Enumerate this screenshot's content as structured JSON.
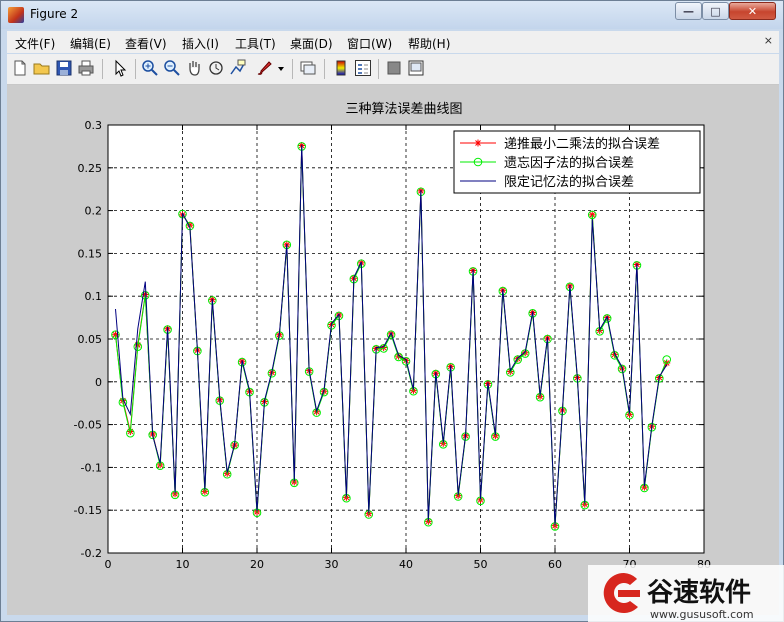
{
  "window": {
    "title": "Figure 2",
    "controls": {
      "minimize": "—",
      "maximize": "□",
      "close": "✕"
    }
  },
  "menubar": {
    "items": [
      "文件(F)",
      "编辑(E)",
      "查看(V)",
      "插入(I)",
      "工具(T)",
      "桌面(D)",
      "窗口(W)",
      "帮助(H)"
    ],
    "close_glyph": "⨯"
  },
  "toolbar": {
    "icons": [
      "new-file-icon",
      "open-folder-icon",
      "save-icon",
      "print-icon",
      "pointer-icon",
      "zoom-in-icon",
      "zoom-out-icon",
      "pan-hand-icon",
      "rotate-3d-icon",
      "data-cursor-icon",
      "brush-icon",
      "dropdown-arrow-icon",
      "link-plot-icon",
      "colorbar-icon",
      "legend-icon",
      "hide-plot-tools-icon",
      "show-plot-tools-icon"
    ]
  },
  "colors": {
    "series1": "#ff0000",
    "series2": "#00ee00",
    "series3": "#000080",
    "figure_bg": "#cccccc"
  },
  "chart_data": {
    "type": "line",
    "title": "三种算法误差曲线图",
    "xlabel": "",
    "ylabel": "",
    "xlim": [
      0,
      80
    ],
    "ylim": [
      -0.2,
      0.3
    ],
    "xticks": [
      "0",
      "10",
      "20",
      "30",
      "40",
      "50",
      "60",
      "70",
      "80"
    ],
    "yticks": [
      "0.3",
      "0.25",
      "0.2",
      "0.15",
      "0.1",
      "0.05",
      "0",
      "-0.05",
      "-0.1",
      "-0.15",
      "-0.2"
    ],
    "grid": true,
    "legend_position": "top-right",
    "x": [
      1,
      2,
      3,
      4,
      5,
      6,
      7,
      8,
      9,
      10,
      11,
      12,
      13,
      14,
      15,
      16,
      17,
      18,
      19,
      20,
      21,
      22,
      23,
      24,
      25,
      26,
      27,
      28,
      29,
      30,
      31,
      32,
      33,
      34,
      35,
      36,
      37,
      38,
      39,
      40,
      41,
      42,
      43,
      44,
      45,
      46,
      47,
      48,
      49,
      50,
      51,
      52,
      53,
      54,
      55,
      56,
      57,
      58,
      59,
      60,
      61,
      62,
      63,
      64,
      65,
      66,
      67,
      68,
      69,
      70,
      71,
      72,
      73,
      74,
      75
    ],
    "series": [
      {
        "name": "递推最小二乘法的拟合误差",
        "marker": "*",
        "color": "#ff0000",
        "values": [
          0.055,
          -0.022,
          -0.058,
          0.043,
          0.102,
          -0.061,
          -0.097,
          0.062,
          -0.131,
          0.195,
          0.183,
          0.037,
          -0.128,
          0.096,
          -0.021,
          -0.107,
          -0.074,
          0.024,
          -0.011,
          -0.152,
          -0.023,
          0.011,
          0.055,
          0.16,
          -0.117,
          0.276,
          0.013,
          -0.035,
          -0.011,
          0.067,
          0.078,
          -0.135,
          0.121,
          0.139,
          -0.154,
          0.039,
          0.04,
          0.056,
          0.03,
          0.025,
          -0.01,
          0.223,
          -0.163,
          0.01,
          -0.072,
          0.018,
          -0.133,
          -0.063,
          0.13,
          -0.138,
          -0.002,
          -0.063,
          0.107,
          0.012,
          0.027,
          0.034,
          0.081,
          -0.017,
          0.051,
          -0.168,
          -0.033,
          0.112,
          0.005,
          -0.143,
          0.195,
          0.06,
          0.075,
          0.032,
          0.016,
          -0.038,
          0.137,
          -0.123,
          -0.052,
          0.005,
          0.022
        ]
      },
      {
        "name": "遗忘因子法的拟合误差",
        "marker": "o",
        "color": "#00ee00",
        "values": [
          0.055,
          -0.024,
          -0.06,
          0.041,
          0.101,
          -0.062,
          -0.098,
          0.061,
          -0.132,
          0.196,
          0.182,
          0.036,
          -0.129,
          0.095,
          -0.022,
          -0.108,
          -0.074,
          0.023,
          -0.012,
          -0.153,
          -0.024,
          0.01,
          0.054,
          0.16,
          -0.118,
          0.275,
          0.012,
          -0.036,
          -0.012,
          0.066,
          0.077,
          -0.136,
          0.12,
          0.138,
          -0.155,
          0.038,
          0.039,
          0.055,
          0.029,
          0.024,
          -0.011,
          0.222,
          -0.164,
          0.009,
          -0.073,
          0.017,
          -0.134,
          -0.064,
          0.129,
          -0.139,
          -0.003,
          -0.064,
          0.106,
          0.011,
          0.026,
          0.033,
          0.08,
          -0.018,
          0.05,
          -0.169,
          -0.034,
          0.111,
          0.004,
          -0.144,
          0.195,
          0.059,
          0.074,
          0.031,
          0.015,
          -0.039,
          0.136,
          -0.124,
          -0.053,
          0.004,
          0.026
        ]
      },
      {
        "name": "限定记忆法的拟合误差",
        "marker": "",
        "color": "#000080",
        "values": [
          0.085,
          -0.02,
          -0.038,
          0.062,
          0.117,
          -0.063,
          -0.095,
          0.064,
          -0.13,
          0.197,
          0.18,
          0.038,
          -0.126,
          0.097,
          -0.02,
          -0.106,
          -0.073,
          0.025,
          -0.01,
          -0.151,
          -0.022,
          0.012,
          0.056,
          0.161,
          -0.116,
          0.277,
          0.014,
          -0.034,
          -0.01,
          0.068,
          0.079,
          -0.134,
          0.122,
          0.14,
          -0.153,
          0.04,
          0.041,
          0.057,
          0.031,
          0.026,
          -0.009,
          0.224,
          -0.162,
          0.011,
          -0.071,
          0.019,
          -0.132,
          -0.062,
          0.131,
          -0.137,
          -0.001,
          -0.062,
          0.108,
          0.013,
          0.028,
          0.035,
          0.082,
          -0.016,
          0.052,
          -0.167,
          -0.032,
          0.113,
          0.006,
          -0.142,
          0.19,
          0.061,
          0.076,
          0.033,
          0.017,
          -0.037,
          0.138,
          -0.122,
          -0.051,
          0.006,
          0.02
        ]
      }
    ]
  },
  "watermark": {
    "brand": "谷速软件",
    "url": "www.gususoft.com"
  }
}
